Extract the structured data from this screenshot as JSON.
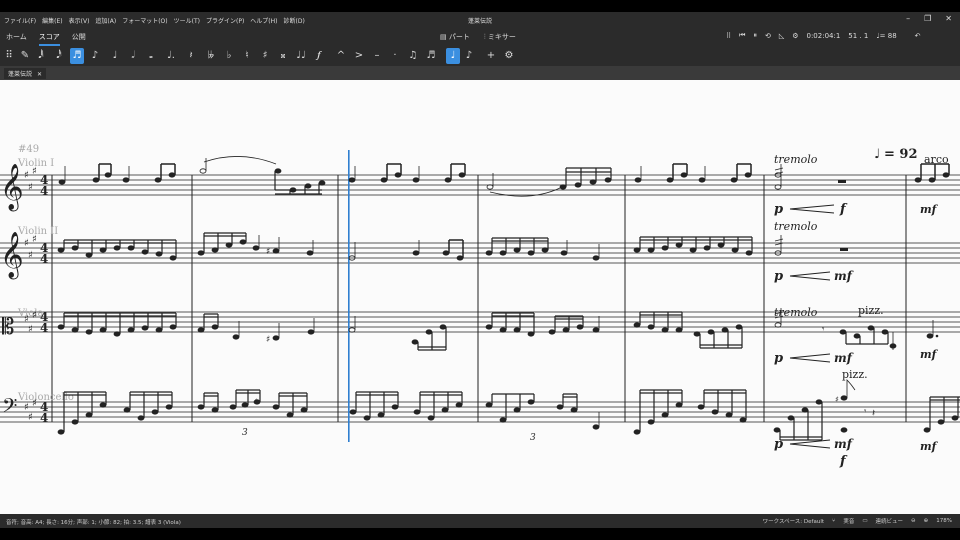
{
  "window": {
    "title": "蓬莱伝説",
    "menu": [
      "ファイル(F)",
      "編集(E)",
      "表示(V)",
      "追加(A)",
      "フォーマット(O)",
      "ツール(T)",
      "プラグイン(P)",
      "ヘルプ(H)",
      "診断(D)"
    ]
  },
  "tabs": {
    "home": "ホーム",
    "score": "スコア",
    "publish": "公開"
  },
  "center_tabs": {
    "parts": "パート",
    "mixer": "ミキサー"
  },
  "playback": {
    "time": "0:02:04:1",
    "position": "51 . 1",
    "tempo": "♩= 88"
  },
  "document_tab": {
    "label": "蓬莱伝説"
  },
  "toolbar": {
    "buttons": [
      "⠿",
      "✎",
      "𝅘𝅥𝅱",
      "𝅘𝅥𝅰",
      "♬",
      "♪",
      "♩",
      "𝅗𝅥",
      "𝅝",
      "♩.",
      "𝄽",
      "𝄫",
      "♭",
      "♮",
      "♯",
      "𝄪",
      "♩♩",
      "𝆑",
      "^",
      ">",
      "–",
      "·",
      "♫",
      "♬",
      "♩",
      "♪",
      "+",
      "⚙"
    ]
  },
  "score": {
    "rehearsal": "#49",
    "instruments": [
      "Violin I",
      "Violin II",
      "Viola",
      "Violoncello"
    ],
    "tempo_mark": "= 92",
    "texts": {
      "tremolo": "tremolo",
      "arco": "arco",
      "pizz": "pizz.",
      "triplet": "3",
      "dyn_p": "p",
      "dyn_f": "f",
      "dyn_mf": "mf"
    }
  },
  "status": {
    "left": "音符; 音高: A4; 長さ: 16分; 声部: 1; 小節: 82; 拍: 3.5; 譜表 3 (Viola)",
    "workspace": "ワークスペース: Default",
    "concert": "実音",
    "view": "連続ビュー",
    "zoom": "178%"
  },
  "colors": {
    "accent": "#3b8fe0",
    "chrome": "#2b2b2b",
    "cursor": "#2f7fd0"
  }
}
